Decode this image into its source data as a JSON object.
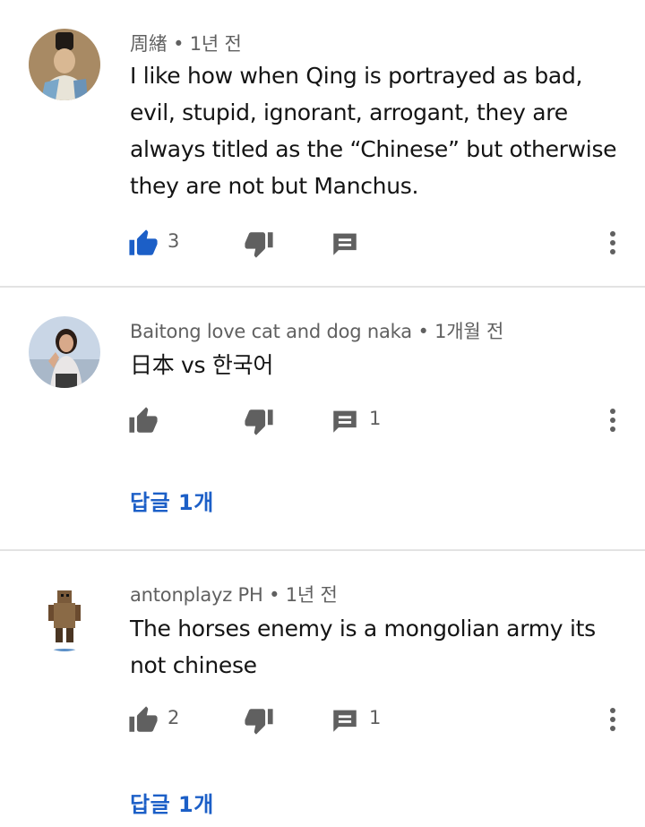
{
  "comments": [
    {
      "author": "周緖",
      "sep": "•",
      "time": "1년 전",
      "lines": [
        "I like how when Qing is portrayed as bad,",
        "evil, stupid, ignorant, arrogant, they are",
        "always titled as the “Chinese” but otherwise",
        "they are not but Manchus."
      ],
      "likes": "3",
      "replies_count": "",
      "liked": true,
      "icons": [
        "like-icon",
        "dislike-icon",
        "reply-icon",
        "more-vert-icon"
      ]
    },
    {
      "author": "Baitong love cat and dog naka",
      "sep": "•",
      "time": "1개월 전",
      "lines": [
        "日本 vs 한국어"
      ],
      "likes": "",
      "replies_count": "1",
      "liked": false,
      "view_replies": "답글 1개"
    },
    {
      "author": "antonplayz PH",
      "sep": "•",
      "time": "1년 전",
      "lines": [
        "The horses enemy is a mongolian army its",
        "not chinese"
      ],
      "likes": "2",
      "replies_count": "1",
      "liked": false,
      "view_replies": "답글 1개"
    }
  ],
  "colors": {
    "accent_blue": "#1c5fc7",
    "icon_gray": "#606060",
    "divider": "#e3e3e3"
  }
}
